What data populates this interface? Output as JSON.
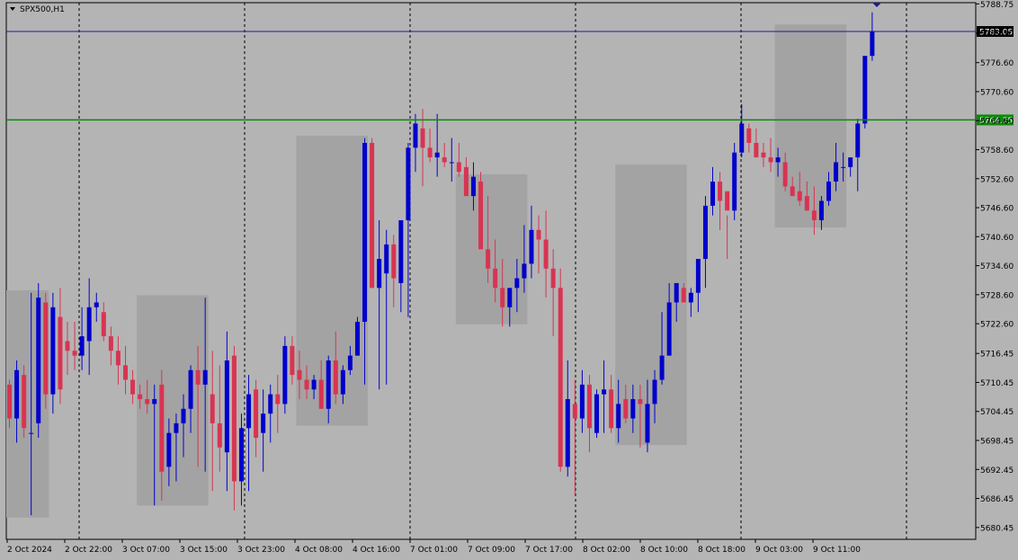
{
  "symbol_label": "SPX500,H1",
  "colors": {
    "background": "#b4b4b4",
    "bull": "#0000cc",
    "bear": "#d83452",
    "session_box": "#a3a3a3",
    "blue_line": "#1c1c8c",
    "green_line": "#0a8a0a",
    "price_tag_dark": "#000000",
    "price_tag_green": "#0a8a0a"
  },
  "chart_data": {
    "type": "candlestick",
    "symbol": "SPX500",
    "timeframe": "H1",
    "ylim": [
      5678.0,
      5789.0
    ],
    "y_ticks": [
      "5788.75",
      "5782.70",
      "5776.60",
      "5770.60",
      "5764.60",
      "5758.60",
      "5752.60",
      "5746.60",
      "5740.60",
      "5734.60",
      "5728.60",
      "5722.60",
      "5716.45",
      "5710.45",
      "5704.45",
      "5698.45",
      "5692.45",
      "5686.45",
      "5680.45"
    ],
    "x_labels": [
      "2 Oct 2024",
      "2 Oct 22:00",
      "3 Oct 07:00",
      "3 Oct 15:00",
      "3 Oct 23:00",
      "4 Oct 08:00",
      "4 Oct 16:00",
      "7 Oct 01:00",
      "7 Oct 09:00",
      "7 Oct 17:00",
      "8 Oct 02:00",
      "8 Oct 10:00",
      "8 Oct 18:00",
      "9 Oct 03:00",
      "9 Oct 11:00"
    ],
    "horizontal_lines": [
      {
        "price": 5783.05,
        "label": "5783.05",
        "style": "blue"
      },
      {
        "price": 5764.75,
        "label": "5764.75",
        "style": "green"
      }
    ],
    "candles": [
      [
        5710,
        5711,
        5701,
        5703
      ],
      [
        5703,
        5715,
        5698,
        5713
      ],
      [
        5712,
        5714,
        5699,
        5701
      ],
      [
        5700,
        5729,
        5683,
        5700
      ],
      [
        5702,
        5731,
        5699,
        5728
      ],
      [
        5727,
        5729,
        5705,
        5708
      ],
      [
        5708,
        5729,
        5704,
        5726
      ],
      [
        5724,
        5730,
        5706,
        5709
      ],
      [
        5719,
        5723,
        5712,
        5717
      ],
      [
        5717,
        5723,
        5713,
        5716
      ],
      [
        5716,
        5726,
        5713,
        5720
      ],
      [
        5719,
        5732,
        5712,
        5726
      ],
      [
        5726,
        5729,
        5723,
        5727
      ],
      [
        5725,
        5727,
        5719,
        5720
      ],
      [
        5720,
        5722,
        5714,
        5717
      ],
      [
        5717,
        5720,
        5710,
        5714
      ],
      [
        5714,
        5718,
        5708,
        5711
      ],
      [
        5711,
        5713,
        5706,
        5708
      ],
      [
        5708,
        5710,
        5705,
        5707
      ],
      [
        5707,
        5711,
        5704,
        5706
      ],
      [
        5706,
        5710,
        5685,
        5707
      ],
      [
        5710,
        5713,
        5686,
        5692
      ],
      [
        5693,
        5703,
        5689,
        5700
      ],
      [
        5700,
        5704,
        5690,
        5702
      ],
      [
        5702,
        5708,
        5695,
        5705
      ],
      [
        5705,
        5714,
        5700,
        5713
      ],
      [
        5713,
        5718,
        5693,
        5710
      ],
      [
        5710,
        5728,
        5692,
        5713
      ],
      [
        5708,
        5717,
        5688,
        5702
      ],
      [
        5702,
        5714,
        5692,
        5697
      ],
      [
        5696,
        5721,
        5688,
        5715
      ],
      [
        5716,
        5718,
        5684,
        5690
      ],
      [
        5690,
        5704,
        5685,
        5701
      ],
      [
        5701,
        5712,
        5688,
        5708
      ],
      [
        5709,
        5711,
        5695,
        5699
      ],
      [
        5700,
        5709,
        5692,
        5704
      ],
      [
        5704,
        5710,
        5698,
        5708
      ],
      [
        5708,
        5712,
        5700,
        5706
      ],
      [
        5706,
        5720,
        5704,
        5718
      ],
      [
        5718,
        5720,
        5710,
        5712
      ],
      [
        5713,
        5717,
        5707,
        5711
      ],
      [
        5711,
        5714,
        5707,
        5709
      ],
      [
        5709,
        5712,
        5707,
        5711
      ],
      [
        5711,
        5715,
        5705,
        5705
      ],
      [
        5705,
        5716,
        5702,
        5715
      ],
      [
        5715,
        5721,
        5706,
        5708
      ],
      [
        5708,
        5714,
        5706,
        5713
      ],
      [
        5713,
        5718,
        5712,
        5716
      ],
      [
        5716,
        5724,
        5716,
        5723
      ],
      [
        5723,
        5761,
        5710,
        5760
      ],
      [
        5760,
        5761,
        5730,
        5730
      ],
      [
        5730,
        5744,
        5709,
        5736
      ],
      [
        5733,
        5742,
        5710,
        5739
      ],
      [
        5739,
        5741,
        5726,
        5732
      ],
      [
        5731,
        5743,
        5725,
        5744
      ],
      [
        5744,
        5760,
        5724,
        5759
      ],
      [
        5759,
        5766,
        5754,
        5764
      ],
      [
        5763,
        5767,
        5751,
        5759
      ],
      [
        5759,
        5763,
        5756,
        5757
      ],
      [
        5757,
        5766,
        5753,
        5758
      ],
      [
        5757,
        5760,
        5755,
        5756
      ],
      [
        5756,
        5761,
        5752,
        5756
      ],
      [
        5756,
        5760,
        5753,
        5754
      ],
      [
        5755,
        5757,
        5750,
        5749
      ],
      [
        5749,
        5756,
        5746,
        5753
      ],
      [
        5752,
        5754,
        5743,
        5738
      ],
      [
        5738,
        5749,
        5731,
        5734
      ],
      [
        5734,
        5740,
        5727,
        5730
      ],
      [
        5730,
        5736,
        5722,
        5726
      ],
      [
        5726,
        5729,
        5722,
        5730
      ],
      [
        5730,
        5736,
        5725,
        5732
      ],
      [
        5732,
        5743,
        5729,
        5735
      ],
      [
        5735,
        5747,
        5732,
        5742
      ],
      [
        5742,
        5745,
        5733,
        5740
      ],
      [
        5740,
        5746,
        5728,
        5734
      ],
      [
        5734,
        5738,
        5720,
        5730
      ],
      [
        5730,
        5734,
        5692,
        5693
      ],
      [
        5693,
        5715,
        5691,
        5707
      ],
      [
        5706,
        5711,
        5687,
        5703
      ],
      [
        5703,
        5713,
        5700,
        5710
      ],
      [
        5710,
        5712,
        5696,
        5701
      ],
      [
        5700,
        5709,
        5699,
        5708
      ],
      [
        5708,
        5715,
        5700,
        5709
      ],
      [
        5709,
        5712,
        5700,
        5701
      ],
      [
        5701,
        5711,
        5698,
        5706
      ],
      [
        5707,
        5710,
        5702,
        5703
      ],
      [
        5703,
        5710,
        5700,
        5707
      ],
      [
        5707,
        5710,
        5697,
        5706
      ],
      [
        5698,
        5711,
        5696,
        5706
      ],
      [
        5706,
        5713,
        5702,
        5711
      ],
      [
        5711,
        5725,
        5710,
        5716
      ],
      [
        5716,
        5731,
        5716,
        5727
      ],
      [
        5727,
        5730,
        5723,
        5731
      ],
      [
        5730,
        5731,
        5727,
        5727
      ],
      [
        5727,
        5730,
        5724,
        5729
      ],
      [
        5729,
        5735,
        5725,
        5736
      ],
      [
        5736,
        5749,
        5730,
        5747
      ],
      [
        5747,
        5755,
        5745,
        5752
      ],
      [
        5752,
        5754,
        5742,
        5748
      ],
      [
        5750,
        5745,
        5736,
        5746
      ],
      [
        5746,
        5760,
        5744,
        5758
      ],
      [
        5758,
        5768,
        5757,
        5764
      ],
      [
        5763,
        5764,
        5758,
        5760
      ],
      [
        5760,
        5763,
        5757,
        5757
      ],
      [
        5758,
        5760,
        5755,
        5757
      ],
      [
        5757,
        5761,
        5754,
        5756
      ],
      [
        5756,
        5759,
        5753,
        5757
      ],
      [
        5756,
        5758,
        5750,
        5751
      ],
      [
        5751,
        5753,
        5749,
        5749
      ],
      [
        5750,
        5754,
        5747,
        5748
      ],
      [
        5749,
        5752,
        5746,
        5746
      ],
      [
        5746,
        5751,
        5741,
        5744
      ],
      [
        5744,
        5749,
        5742,
        5748
      ],
      [
        5748,
        5754,
        5747,
        5752
      ],
      [
        5752,
        5760,
        5750,
        5756
      ],
      [
        5755,
        5758,
        5752,
        5755
      ],
      [
        5755,
        5757,
        5753,
        5757
      ],
      [
        5757,
        5765,
        5750,
        5764
      ],
      [
        5764,
        5776,
        5763,
        5778
      ],
      [
        5778,
        5787,
        5777,
        5783
      ]
    ],
    "session_boxes": [
      {
        "from_index": 0,
        "to_index": 5,
        "high": 5729.5,
        "low": 5682.5
      },
      {
        "from_index": 18,
        "to_index": 27,
        "high": 5728.5,
        "low": 5685.0
      },
      {
        "from_index": 40,
        "to_index": 49,
        "high": 5761.5,
        "low": 5701.5
      },
      {
        "from_index": 62,
        "to_index": 71,
        "high": 5753.5,
        "low": 5722.5
      },
      {
        "from_index": 84,
        "to_index": 93,
        "high": 5755.5,
        "low": 5697.5
      },
      {
        "from_index": 106,
        "to_index": 115,
        "high": 5784.5,
        "low": 5742.5
      }
    ]
  }
}
